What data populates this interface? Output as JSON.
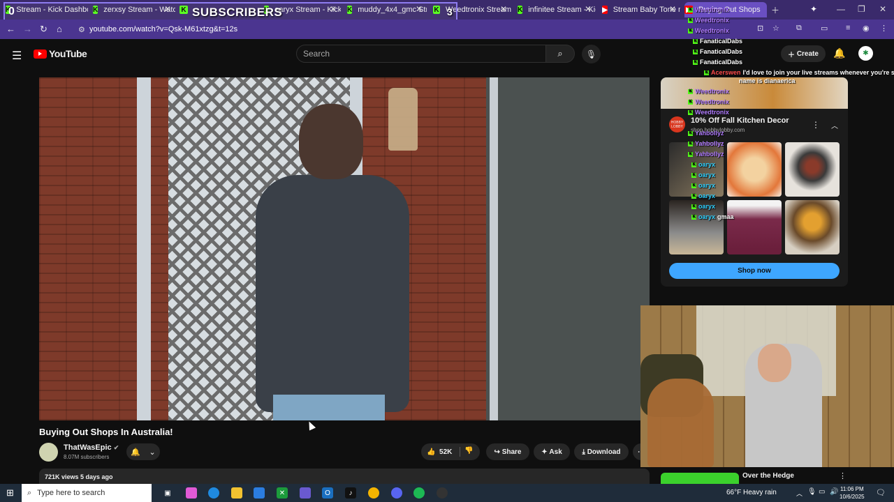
{
  "browser": {
    "tabs": [
      {
        "label": "Stream - Kick Dashbo",
        "icon": "kick"
      },
      {
        "label": "zerxsy Stream - Watc",
        "icon": "kick"
      },
      {
        "label": "",
        "icon": "kick"
      },
      {
        "label": "oaryx Stream - Kick I",
        "icon": "kick"
      },
      {
        "label": "muddy_4x4_gmc Stre",
        "icon": "kick"
      },
      {
        "label": "Weedtronix Stream",
        "icon": "kick"
      },
      {
        "label": "infinitee Stream - Kic",
        "icon": "kick"
      },
      {
        "label": "Stream Baby Tone m",
        "icon": "yt"
      },
      {
        "label": "Buying Out Shops",
        "icon": "yt"
      }
    ],
    "url": "youtube.com/watch?v=Qsk-M61xtzg&t=12s"
  },
  "overlay": {
    "subscribers_label": "SUBSCRIBERS",
    "zero": "0",
    "count": "3"
  },
  "youtube": {
    "logo": "YouTube",
    "search_placeholder": "Search",
    "create_label": "Create",
    "video": {
      "title": "Buying Out Shops In Australia!",
      "channel": "ThatWasEpic",
      "subscribers": "8.07M subscribers",
      "likes": "52K",
      "share": "Share",
      "ask": "Ask",
      "download": "Download",
      "views_date": "721K views  5 days ago"
    },
    "ad": {
      "title": "10% Off Fall Kitchen Decor",
      "domain": "shop.hobbylobby.com",
      "logo_text": "HOBBY LOBBY",
      "cta": "Shop now"
    },
    "next_video": "Over the Hedge"
  },
  "chat": [
    {
      "user": "FanaticalDabs",
      "color": "#ffffff",
      "msg": ""
    },
    {
      "user": "FanaticalDabs",
      "color": "#ffffff",
      "msg": ""
    },
    {
      "user": "FanaticalDabs",
      "color": "#ffffff",
      "msg": ""
    },
    {
      "user": "Acerswen",
      "color": "#ff4d4d",
      "msg": "I'd love to join your live streams whenever you're streaming. A"
    },
    {
      "user": "",
      "color": "#ffffff",
      "msg": "name is dianaerica"
    },
    {
      "user": "Weedtronix",
      "color": "#b07cff",
      "msg": ""
    },
    {
      "user": "Weedtronix",
      "color": "#b07cff",
      "msg": ""
    },
    {
      "user": "Weedtronix",
      "color": "#b07cff",
      "msg": ""
    },
    {
      "user": "Yahbollyz",
      "color": "#b07cff",
      "msg": ""
    },
    {
      "user": "Yahbollyz",
      "color": "#b07cff",
      "msg": ""
    },
    {
      "user": "oaryx",
      "color": "#2fd0ff",
      "msg": ""
    },
    {
      "user": "oaryx",
      "color": "#2fd0ff",
      "msg": ""
    },
    {
      "user": "oaryx",
      "color": "#2fd0ff",
      "msg": ""
    },
    {
      "user": "oaryx",
      "color": "#2fd0ff",
      "msg": ""
    },
    {
      "user": "oaryx",
      "color": "#2fd0ff",
      "msg": ""
    },
    {
      "user": "oaryx",
      "color": "#2fd0ff",
      "msg": "gmaa"
    }
  ],
  "chat_top": [
    {
      "user": "Weedtronix",
      "color": "#b07cff"
    },
    {
      "user": "Weedtronix",
      "color": "#b07cff"
    }
  ],
  "taskbar": {
    "search_placeholder": "Type here to search",
    "weather": "66°F  Heavy rain",
    "time": "11:06 PM",
    "date": "10/6/2025"
  }
}
